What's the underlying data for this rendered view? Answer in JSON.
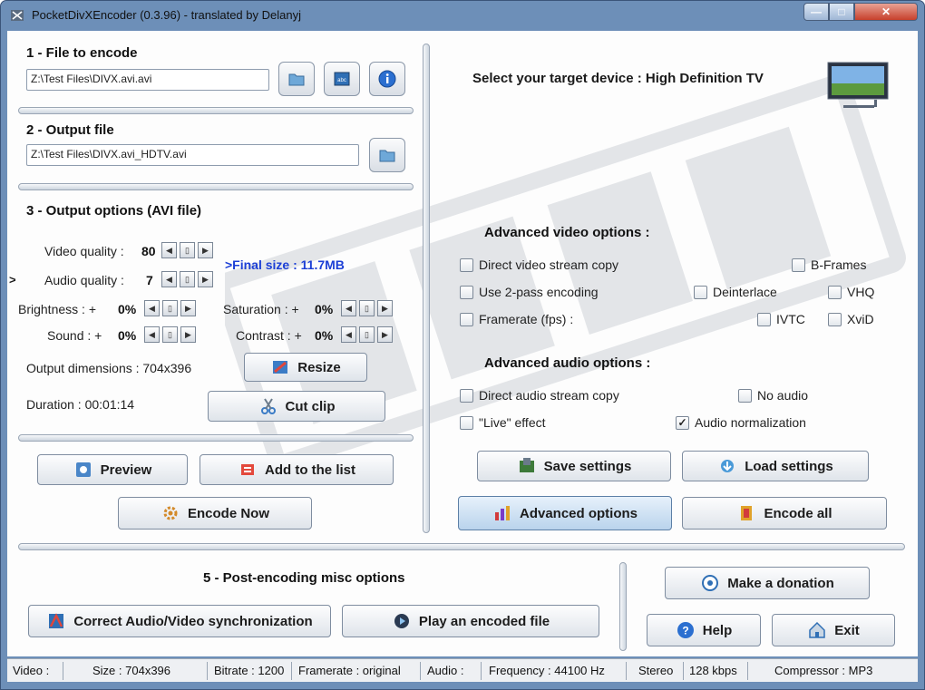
{
  "window": {
    "title": "PocketDivXEncoder (0.3.96) - translated by Delanyj",
    "min": "—",
    "max": "□",
    "close": "✕"
  },
  "section1": {
    "heading": "1 - File to encode",
    "input_path": "Z:\\Test Files\\DIVX.avi.avi"
  },
  "section2": {
    "heading": "2 - Output file",
    "output_path": "Z:\\Test Files\\DIVX.avi_HDTV.avi"
  },
  "section3": {
    "heading": "3 - Output options (AVI file)",
    "video_quality_label": "Video quality :",
    "video_quality_value": "80",
    "audio_quality_label": "Audio quality :",
    "audio_quality_value": "7",
    "final_size": ">Final size : 11.7MB",
    "expander": ">",
    "brightness_label": "Brightness : +",
    "brightness_value": "0%",
    "saturation_label": "Saturation : +",
    "saturation_value": "0%",
    "sound_label": "Sound : +",
    "sound_value": "0%",
    "contrast_label": "Contrast : +",
    "contrast_value": "0%",
    "dimensions": "Output dimensions : 704x396",
    "resize_label": "Resize",
    "duration": "Duration : 00:01:14",
    "cut_clip_label": "Cut clip"
  },
  "left_actions": {
    "preview": "Preview",
    "add_to_list": "Add to the list",
    "encode_now": "Encode Now"
  },
  "device": {
    "prompt": "Select your target device : High Definition TV"
  },
  "video_options": {
    "heading": "Advanced video options :",
    "direct_copy": "Direct video stream copy",
    "two_pass": "Use 2-pass encoding",
    "framerate": "Framerate (fps) :",
    "bframes": "B-Frames",
    "deinterlace": "Deinterlace",
    "vhq": "VHQ",
    "ivtc": "IVTC",
    "xvid": "XviD"
  },
  "audio_options": {
    "heading": "Advanced audio options :",
    "direct_copy": "Direct audio stream copy",
    "no_audio": "No audio",
    "live_effect": "\"Live\" effect",
    "normalization": "Audio normalization",
    "checkmark": "✓"
  },
  "right_actions": {
    "save": "Save settings",
    "load": "Load settings",
    "advanced": "Advanced options",
    "encode_all": "Encode all"
  },
  "section5": {
    "heading": "5 - Post-encoding misc options",
    "sync": "Correct Audio/Video synchronization",
    "play": "Play an encoded file"
  },
  "bottom_actions": {
    "donate": "Make a donation",
    "help": "Help",
    "exit": "Exit"
  },
  "status": {
    "video": "Video :",
    "size": "Size : 704x396",
    "bitrate": "Bitrate : 1200",
    "framerate": "Framerate : original",
    "audio": "Audio :",
    "frequency": "Frequency : 44100 Hz",
    "channels": "Stereo",
    "audio_bitrate": "128 kbps",
    "compressor": "Compressor : MP3"
  },
  "colors": {
    "final_size": "#1c3fd6",
    "title_bar": "#6d8fb8",
    "close_button": "#c7402b"
  }
}
